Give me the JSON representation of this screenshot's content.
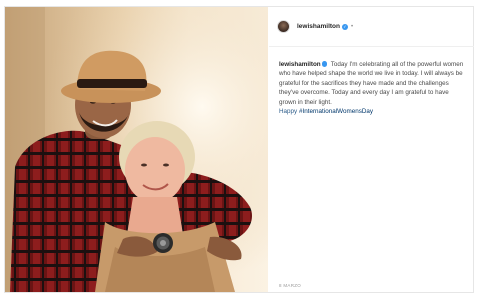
{
  "post": {
    "header_handle": "lewishamilton",
    "header_separator": "•",
    "caption_handle": "lewishamilton",
    "caption_text": "Today I'm celebrating all of the powerful women who have helped shape the world we live in today. I will always be grateful for the sacrifices they have made and the challenges they've overcome. Today and every day I am grateful to have grown in their light.",
    "caption_happy": "Happy",
    "hashtag": "#InternationalWomensDay",
    "date": "8 MARZO"
  },
  "colors": {
    "verified_badge": "#3897f0",
    "hashtag": "#00376b",
    "text": "#262626"
  },
  "icons": [
    "avatar",
    "verified-badge-icon"
  ]
}
